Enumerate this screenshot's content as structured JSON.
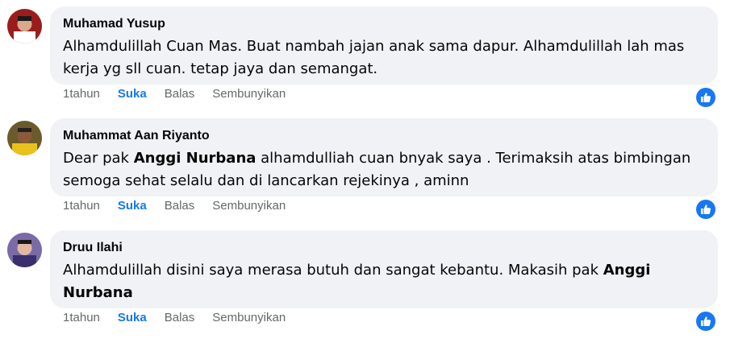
{
  "comments": [
    {
      "author": "Muhamad Yusup",
      "segments": [
        {
          "text": "Alhamdulillah Cuan Mas. Buat nambah jajan anak sama dapur. Alhamdulillah lah mas\nkerja yg sll cuan. tetap jaya dan semangat.",
          "bold": false
        }
      ],
      "time": "1tahun",
      "like_label": "Suka",
      "reply_label": "Balas",
      "hide_label": "Sembunyikan",
      "avatar_colors": {
        "bg": "#9b1c1c",
        "face": "#d9a98a",
        "shirt": "#ffffff"
      }
    },
    {
      "author": "Muhammat Aan Riyanto",
      "segments": [
        {
          "text": "Dear pak ",
          "bold": false
        },
        {
          "text": "Anggi Nurbana",
          "bold": true
        },
        {
          "text": " alhamdulliah cuan bnyak saya . Terimaksih atas bimbingan\nsemoga sehat selalu dan di lancarkan rejekinya , aminn",
          "bold": false
        }
      ],
      "time": "1tahun",
      "like_label": "Suka",
      "reply_label": "Balas",
      "hide_label": "Sembunyikan",
      "avatar_colors": {
        "bg": "#6b5a2a",
        "face": "#8a5a3a",
        "shirt": "#e8c21a"
      }
    },
    {
      "author": "Druu Ilahi",
      "segments": [
        {
          "text": "Alhamdulillah disini saya merasa butuh dan sangat kebantu. Makasih pak ",
          "bold": false
        },
        {
          "text": "Anggi\nNurbana",
          "bold": true
        }
      ],
      "time": "1tahun",
      "like_label": "Suka",
      "reply_label": "Balas",
      "hide_label": "Sembunyikan",
      "avatar_colors": {
        "bg": "#7a6aa8",
        "face": "#e2b9a0",
        "shirt": "#3a2f6e"
      }
    }
  ],
  "colors": {
    "accent": "#1877f2",
    "bubble": "#f0f2f5",
    "meta": "#65676b"
  },
  "reaction_icon": "thumbs-up-icon"
}
